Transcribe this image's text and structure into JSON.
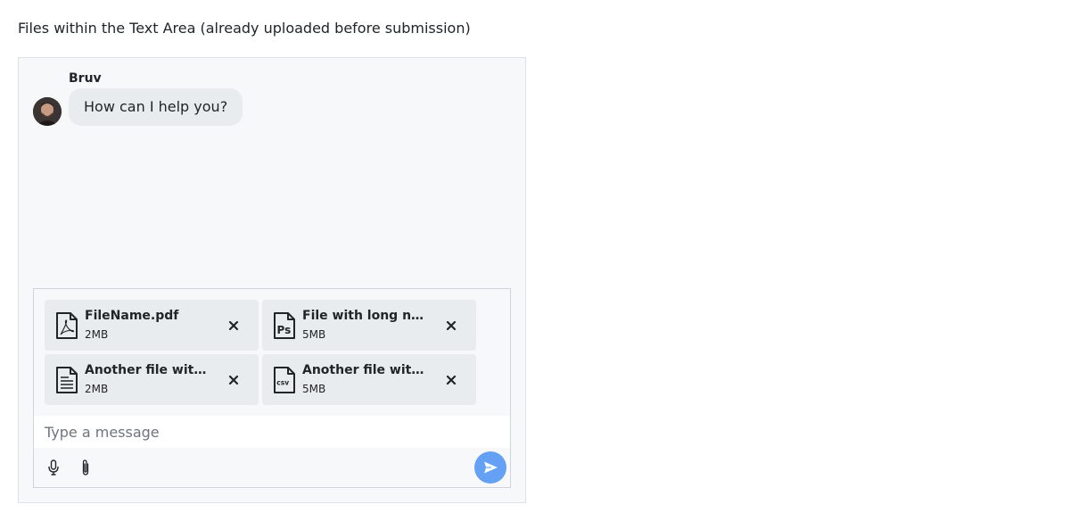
{
  "page": {
    "heading": "Files within the Text Area (already uploaded before submission)"
  },
  "chat": {
    "message": {
      "sender": "Bruv",
      "text": "How can I help you?",
      "avatar_icon": "user-avatar-photo"
    }
  },
  "composer": {
    "attachments": [
      {
        "name": "FileName.pdf",
        "size": "2MB",
        "icon": "pdf-file-icon"
      },
      {
        "name": "File with long name.psd",
        "size": "5MB",
        "icon": "photoshop-file-icon"
      },
      {
        "name": "Another file with long name.txt",
        "size": "2MB",
        "icon": "text-file-icon"
      },
      {
        "name": "Another file with long name.csv",
        "size": "5MB",
        "icon": "csv-file-icon"
      }
    ],
    "input": {
      "value": "",
      "placeholder": "Type a message"
    },
    "toolbar": {
      "mic_icon": "microphone-icon",
      "attach_icon": "paperclip-icon",
      "send_icon": "send-icon"
    }
  },
  "colors": {
    "accent": "#64a0f4",
    "bubble": "#e9ecef",
    "panel": "#f7f8fa",
    "text": "#212529"
  }
}
